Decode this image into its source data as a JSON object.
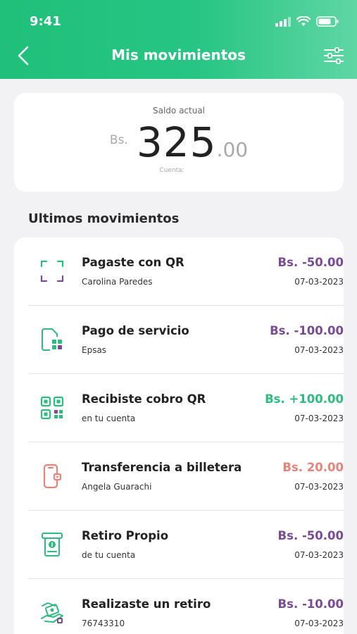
{
  "status_bar": {
    "time": "9:41",
    "icons": [
      "signal-icon",
      "wifi-icon",
      "battery-icon"
    ]
  },
  "nav": {
    "title": "Mis movimientos",
    "back_icon": "chevron-left-icon",
    "filter_icon": "sliders-icon"
  },
  "balance": {
    "label": "Saldo actual",
    "currency": "Bs.",
    "amount_integer": "325",
    "amount_decimal": ".00",
    "account_label": "Cuenta:"
  },
  "section_title": "Ultimos movimientos",
  "colors": {
    "brand_green": "#27c584",
    "negative_purple": "#7b4a96",
    "positive_green": "#2bbd7e",
    "salmon": "#e8837a"
  },
  "transactions": [
    {
      "icon": "qr-scan-icon",
      "title": "Pagaste con QR",
      "subtitle": "Carolina Paredes",
      "amount": "Bs. -50.00",
      "date": "07-03-2023",
      "amount_color": "#7b4a96"
    },
    {
      "icon": "service-bill-icon",
      "title": "Pago de servicio",
      "subtitle": "Epsas",
      "amount": "Bs. -100.00",
      "date": "07-03-2023",
      "amount_color": "#7b4a96"
    },
    {
      "icon": "qr-code-icon",
      "title": "Recibiste cobro QR",
      "subtitle": "en tu cuenta",
      "amount": "Bs. +100.00",
      "date": "07-03-2023",
      "amount_color": "#2bbd7e"
    },
    {
      "icon": "phone-wallet-icon",
      "title": "Transferencia a billetera",
      "subtitle": "Angela Guarachi",
      "amount": "Bs. 20.00",
      "date": "07-03-2023",
      "amount_color": "#e8837a"
    },
    {
      "icon": "atm-cash-icon",
      "title": "Retiro Propio",
      "subtitle": "de tu cuenta",
      "amount": "Bs. -50.00",
      "date": "07-03-2023",
      "amount_color": "#7b4a96"
    },
    {
      "icon": "hand-cash-icon",
      "title": "Realizaste un retiro",
      "subtitle": "76743310",
      "amount": "Bs. -10.00",
      "date": "07-03-2023",
      "amount_color": "#7b4a96"
    }
  ]
}
